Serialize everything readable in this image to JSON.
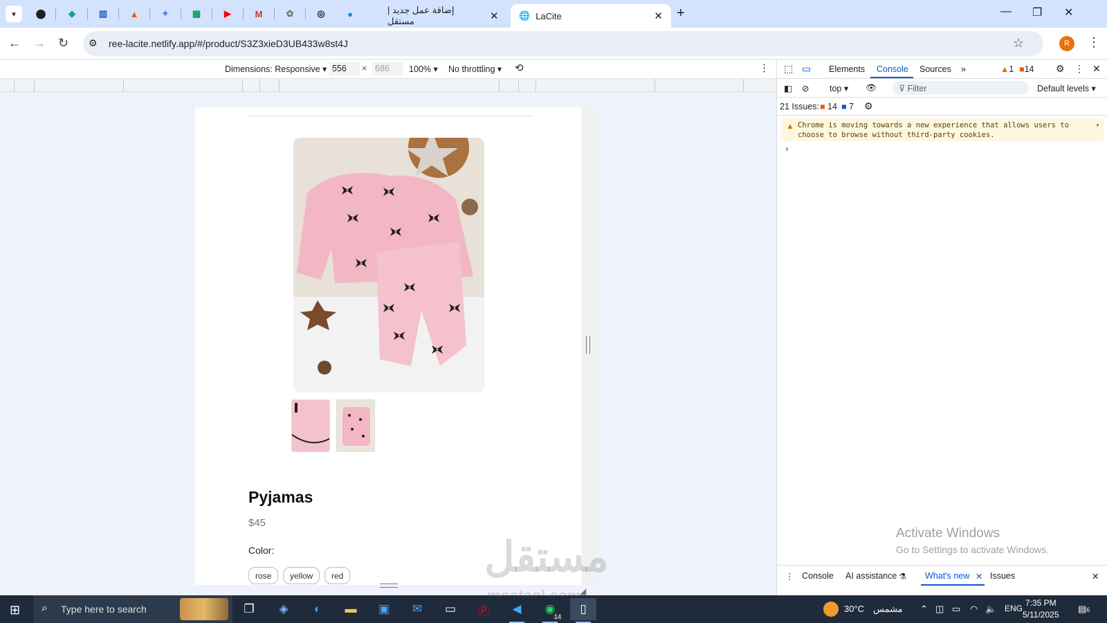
{
  "browser": {
    "tabs": [
      {
        "title": "إضافة عمل جديد | مستقل",
        "active": false
      },
      {
        "title": "LaCite",
        "active": true
      }
    ],
    "url": "ree-lacite.netlify.app/#/product/S3Z3xieD3UB433w8st4J",
    "profile_initial": "R"
  },
  "device_toolbar": {
    "dimensions": "Dimensions: Responsive",
    "width": "556",
    "times": "×",
    "height": "686",
    "zoom": "100%",
    "throttling": "No throttling"
  },
  "product": {
    "title": "Pyjamas",
    "price": "$45",
    "color_label": "Color:",
    "colors": [
      "rose",
      "yellow",
      "red"
    ]
  },
  "devtools": {
    "tabs": [
      "Elements",
      "Console",
      "Sources"
    ],
    "active_tab": "Console",
    "warning_count": "1",
    "issue_count": "14",
    "context": "top",
    "filter_placeholder": "Filter",
    "levels": "Default levels",
    "issues_label": "21 Issues:",
    "issues_warn": "14",
    "issues_info": "7",
    "message": "Chrome is moving towards a new experience that allows users to choose to browse without third-party cookies.",
    "drawer_tabs": [
      "Console",
      "AI assistance",
      "What's new",
      "Issues"
    ],
    "activate_title": "Activate Windows",
    "activate_sub": "Go to Settings to activate Windows."
  },
  "taskbar": {
    "search_placeholder": "Type here to search",
    "whatsapp_badge": "14",
    "temperature": "30°C",
    "weather": "مشمس",
    "language": "ENG",
    "time": "7:35 PM",
    "date": "5/11/2025",
    "notifications": "6"
  },
  "watermark": {
    "text": "مستقل",
    "sub": "mostaql.com"
  },
  "colors": {
    "accent": "#0b57d0",
    "tabstrip": "#d3e3fd",
    "pink": "#f2b6c4"
  }
}
